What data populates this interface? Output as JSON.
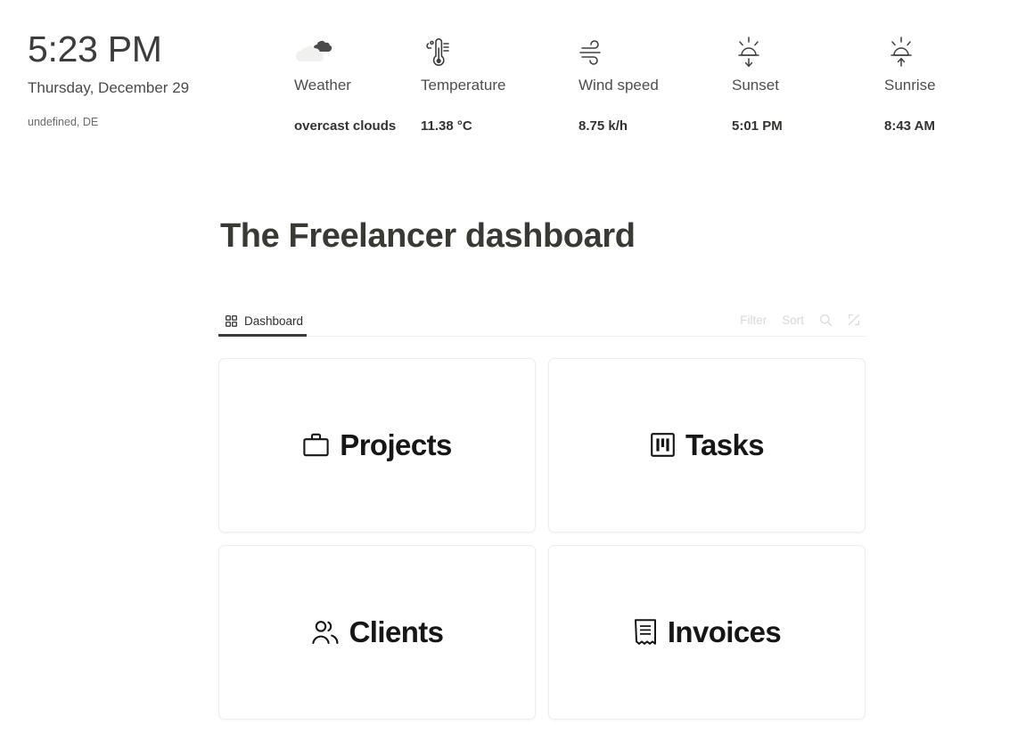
{
  "status_bar": {
    "time": "5:23 PM",
    "date": "Thursday, December 29",
    "location": "undefined, DE",
    "metrics": [
      {
        "icon": "overcast-clouds-icon",
        "label": "Weather",
        "value": "overcast clouds"
      },
      {
        "icon": "thermometer-icon",
        "label": "Temperature",
        "value": "11.38 °C"
      },
      {
        "icon": "wind-icon",
        "label": "Wind speed",
        "value": "8.75 k/h"
      },
      {
        "icon": "sunset-icon",
        "label": "Sunset",
        "value": "5:01 PM"
      },
      {
        "icon": "sunrise-icon",
        "label": "Sunrise",
        "value": "8:43 AM"
      }
    ]
  },
  "main": {
    "title": "The Freelancer dashboard",
    "tabs": [
      {
        "label": "Dashboard",
        "icon": "grid-icon",
        "active": true
      }
    ],
    "tab_actions": {
      "filter_label": "Filter",
      "sort_label": "Sort",
      "search_icon": "search-icon",
      "expand_icon": "expand-diagonal-icon"
    },
    "cards": [
      {
        "label": "Projects",
        "icon": "briefcase-icon"
      },
      {
        "label": "Tasks",
        "icon": "kanban-board-icon"
      },
      {
        "label": "Clients",
        "icon": "users-icon"
      },
      {
        "label": "Invoices",
        "icon": "receipt-icon"
      }
    ]
  },
  "colors": {
    "heading": "#3a3a35",
    "card_label": "#161616",
    "muted_text": "#d9d9d9",
    "accent_underline": "#3b3b3b",
    "card_border": "#ededed"
  }
}
